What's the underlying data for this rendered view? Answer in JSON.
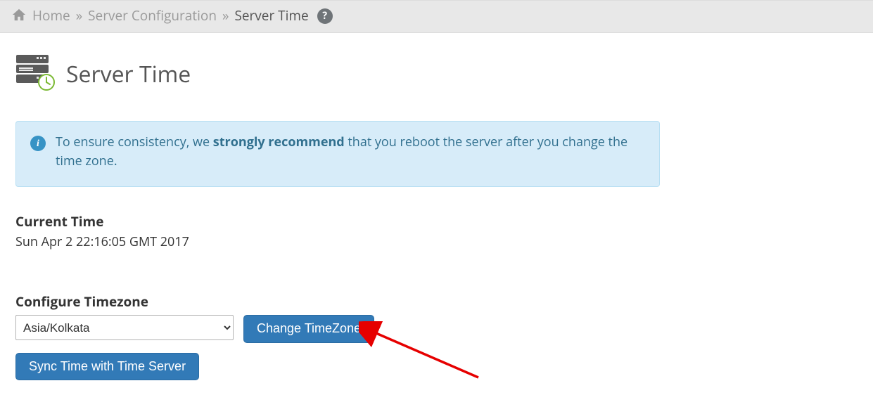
{
  "breadcrumb": {
    "home": "Home",
    "sep": "»",
    "section": "Server Configuration",
    "current": "Server Time"
  },
  "header": {
    "title": "Server Time"
  },
  "alert": {
    "pre": "To ensure consistency, we ",
    "strong": "strongly recommend",
    "post": " that you reboot the server after you change the time zone."
  },
  "current_time": {
    "label": "Current Time",
    "value": "Sun Apr 2 22:16:05 GMT 2017"
  },
  "timezone": {
    "label": "Configure Timezone",
    "selected": "Asia/Kolkata",
    "change_button": "Change TimeZone",
    "sync_button": "Sync Time with Time Server"
  }
}
